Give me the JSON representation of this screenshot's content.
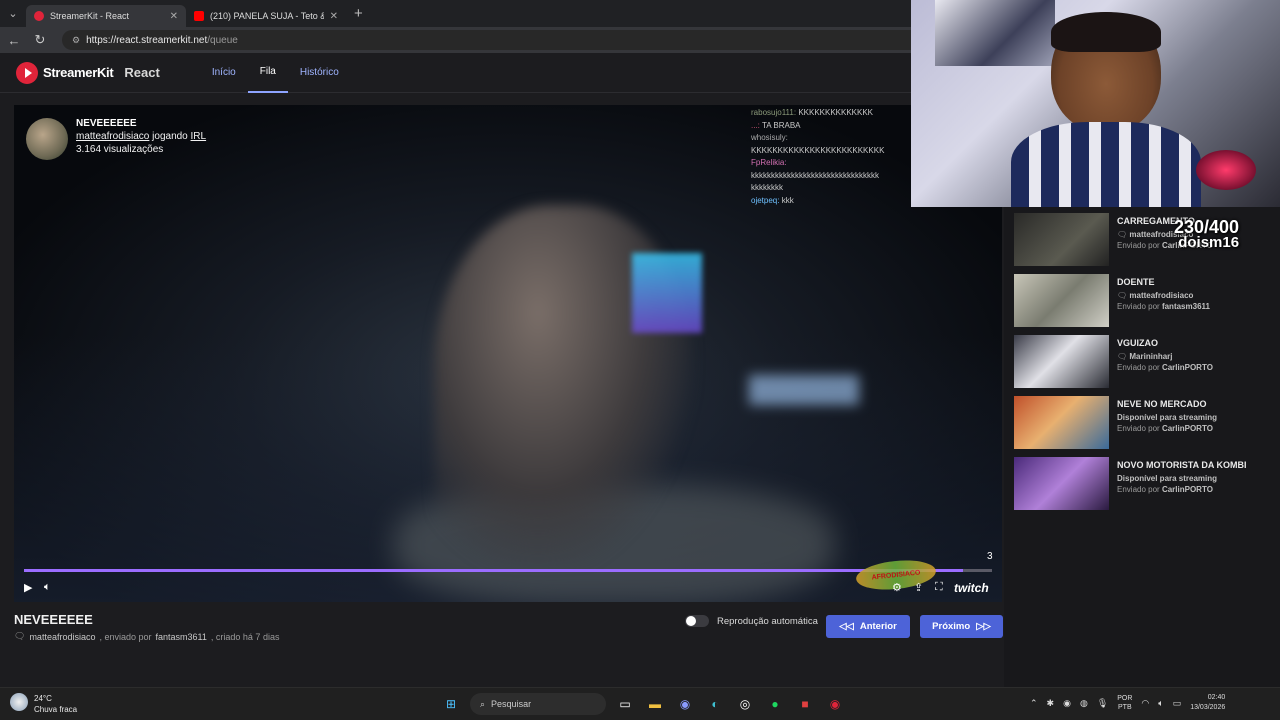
{
  "browser": {
    "tabs": [
      {
        "title": "StreamerKit - React",
        "color": "#e0243a",
        "active": true
      },
      {
        "title": "(210) PANELA SUJA - Teto & WIU",
        "color": "#ff0000",
        "active": false
      }
    ],
    "url_host": "https://react.streamerkit.net",
    "url_path": "/queue"
  },
  "app": {
    "logo_text": "StreamerKit",
    "logo_sub": "React",
    "nav": [
      "Início",
      "Fila",
      "Histórico"
    ],
    "active_nav": "Fila"
  },
  "player": {
    "video_title": "NEVEEEEEE",
    "channel": "matteafrodisiaco",
    "playing_word": "jogando",
    "category": "IRL",
    "views": "3.164 visualizações",
    "counter": "3",
    "progress": 0.97,
    "twitch_label": "twitch",
    "watermark_label": "AFRODISIACO",
    "chat": [
      {
        "user": "rabosujo111:",
        "msg": "KKKKKKKKKKKKKK"
      },
      {
        "user": "...:",
        "msg": "TA BRABA"
      },
      {
        "user": "whosisuly:",
        "msg": "KKKKKKKKKKKKKKKKKKKKKKKKK"
      },
      {
        "user": "FpRelikia:",
        "msg": "kkkkkkkkkkkkkkkkkkkkkkkkkkkkkkkk kkkkkkkk"
      },
      {
        "user": "ojetpeq:",
        "msg": "kkk"
      }
    ]
  },
  "details": {
    "title": "NEVEEEEEE",
    "channel": "matteafrodisiaco",
    "sent_by_label": ", enviado por",
    "sent_by": "fantasm3611",
    "created": ", criado há 7 dias",
    "autoplay_label": "Reprodução automática",
    "prev_label": "Anterior",
    "next_label": "Próximo"
  },
  "queue": [
    {
      "title": "CARREGAMENTO",
      "channel": "matteafrodisiaco",
      "sender_prefix": "Enviado por",
      "sender": "CarlinPORTO",
      "thumb": "#3a3a38"
    },
    {
      "title": "DOENTE",
      "channel": "matteafrodisiaco",
      "sender_prefix": "Enviado por",
      "sender": "fantasm3611",
      "thumb": "#9a9c8e"
    },
    {
      "title": "VGUIZAO",
      "channel": "Marininharj",
      "sender_prefix": "Enviado por",
      "sender": "CarlinPORTO",
      "thumb": "#4a4c58"
    },
    {
      "title": "NEVE NO MERCADO",
      "channel": "Disponível para streaming",
      "sender_prefix": "Enviado por",
      "sender": "CarlinPORTO",
      "thumb": "#a86a3a"
    },
    {
      "title": "NOVO MOTORISTA DA KOMBI",
      "channel": "Disponível para streaming",
      "sender_prefix": "Enviado por",
      "sender": "CarlinPORTO",
      "thumb": "#7a4aa8"
    }
  ],
  "overlay": {
    "count": "230/400",
    "user": "doism16"
  },
  "taskbar": {
    "temp": "24°C",
    "weather": "Chuva fraca",
    "search_placeholder": "Pesquisar",
    "lang1": "POR",
    "lang2": "PTB",
    "time": "02:40",
    "date": "13/03/2026"
  }
}
